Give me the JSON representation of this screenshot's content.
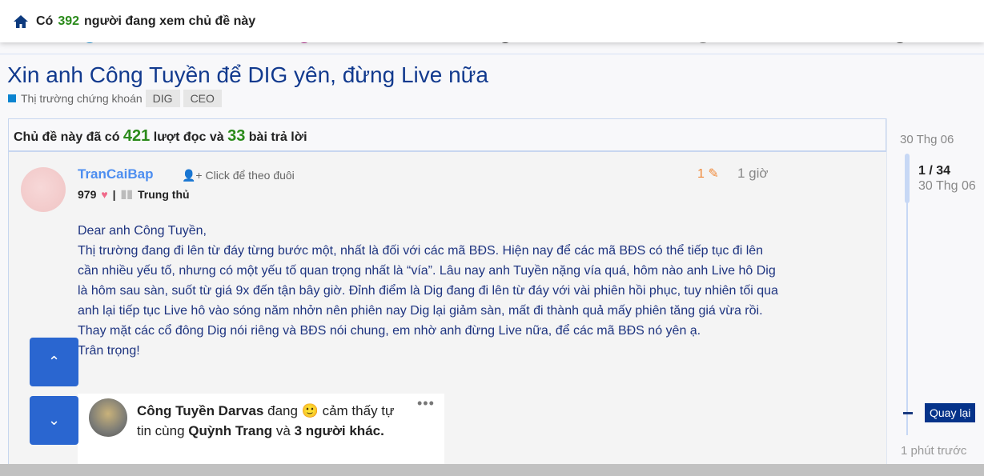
{
  "topbar": {
    "prefix": "Có",
    "count": "392",
    "suffix": "người đang xem chủ đề này"
  },
  "topic": {
    "title": "Xin anh Công Tuyền để DIG yên, đừng Live nữa",
    "category": "Thị trường chứng khoán",
    "tags": [
      "DIG",
      "CEO"
    ]
  },
  "stats": {
    "prefix": "Chủ đề này đã có",
    "views": "421",
    "middle": "lượt đọc và",
    "replies": "33",
    "suffix": "bài trả lời"
  },
  "post": {
    "username": "TranCaiBap",
    "follow": "Click để theo đuôi",
    "likes": "979",
    "separator": "|",
    "rank": "Trung thủ",
    "edits": "1",
    "time": "1 giờ",
    "body": [
      "Dear anh Công Tuyền,",
      "Thị trường đang đi lên từ đáy từng bước một, nhất là đối với các mã BĐS. Hiện nay để các mã BĐS có thể tiếp tục đi lên cần nhiều yếu tố, nhưng có một yếu tố quan trọng nhất là “vía”. Lâu nay anh Tuyền nặng vía quá, hôm nào anh Live hô Dig là hôm sau sàn, suốt từ giá 9x đến tận bây giờ. Đỉnh điểm là Dig đang đi lên từ đáy với vài phiên hồi phục, tuy nhiên tối qua anh lại tiếp tục Live hô vào sóng năm nhởn nên phiên nay Dig lại giảm sàn, mất đi thành quả mấy phiên tăng giá vừa rồi.",
      "Thay mặt các cổ đông Dig nói riêng và BĐS nói chung, em nhờ anh đừng Live nữa, để các mã BĐS nó yên ạ.",
      "Trân trọng!"
    ],
    "embed": {
      "name": "Công Tuyền Darvas",
      "status1": "đang",
      "status2": "cảm thấy tự tin cùng",
      "friend": "Quỳnh Trang",
      "and": "và",
      "others": "3 người khác."
    }
  },
  "timeline": {
    "start": "30 Thg 06",
    "position": "1 / 34",
    "position_date": "30 Thg 06",
    "back": "Quay lại",
    "end": "1 phút trước"
  },
  "colors": {
    "accent": "#2a66d0",
    "green": "#2a8a1a",
    "title": "#123a8e"
  }
}
